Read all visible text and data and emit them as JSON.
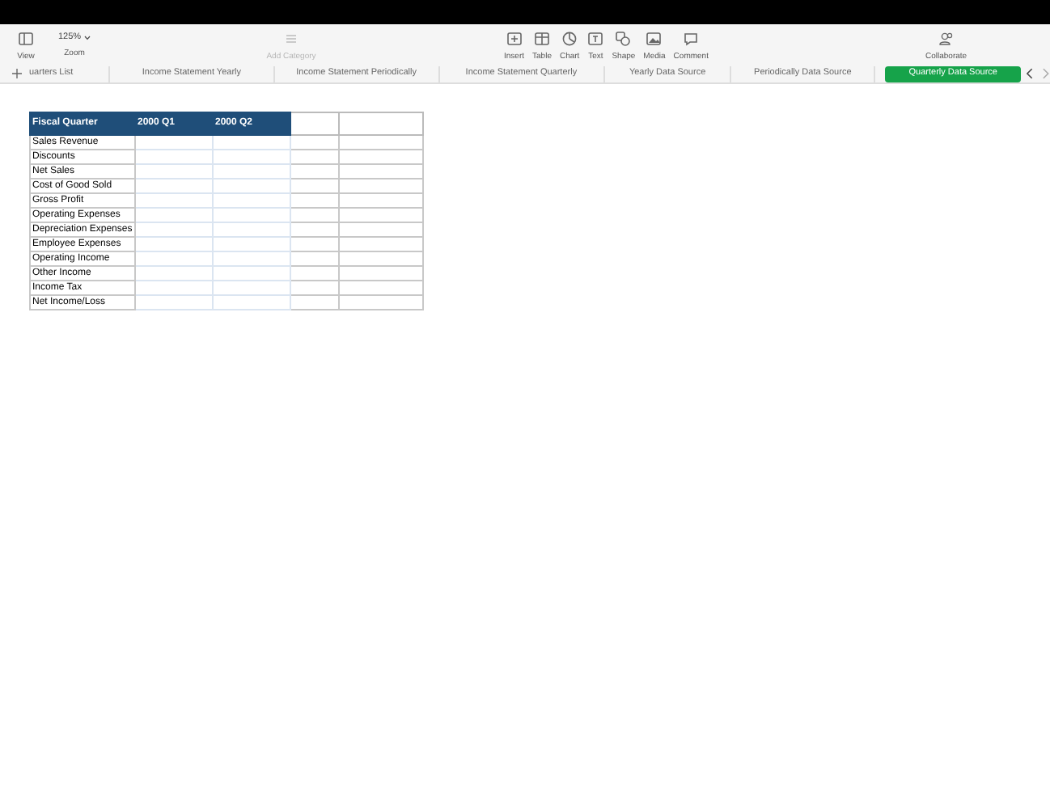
{
  "toolbar": {
    "left": [
      {
        "kind": "view",
        "label": "View"
      },
      {
        "kind": "zoom",
        "label": "Zoom",
        "value": "125%"
      }
    ],
    "add_category": {
      "label": "Add Category",
      "disabled": true
    },
    "center": [
      {
        "kind": "insert",
        "label": "Insert"
      },
      {
        "kind": "table",
        "label": "Table"
      },
      {
        "kind": "chart",
        "label": "Chart"
      },
      {
        "kind": "text",
        "label": "Text"
      },
      {
        "kind": "shape",
        "label": "Shape"
      },
      {
        "kind": "media",
        "label": "Media"
      },
      {
        "kind": "comment",
        "label": "Comment"
      }
    ],
    "right": {
      "label": "Collaborate"
    }
  },
  "tabs": [
    {
      "label": "uarters List",
      "selected": false
    },
    {
      "label": "Income Statement Yearly",
      "selected": false
    },
    {
      "label": "Income Statement Periodically",
      "selected": false
    },
    {
      "label": "Income Statement Quarterly",
      "selected": false
    },
    {
      "label": "Yearly Data Source",
      "selected": false
    },
    {
      "label": "Periodically Data Source",
      "selected": false
    },
    {
      "label": "Quarterly Data Source",
      "selected": true
    }
  ],
  "table": {
    "columns": [
      "Fiscal Quarter",
      "2000 Q1",
      "2000 Q2"
    ],
    "rows": [
      "Sales Revenue",
      "Discounts",
      "Net Sales",
      "Cost of Good Sold",
      "Gross Profit",
      "Operating Expenses",
      "Depreciation Expenses",
      "Employee Expenses",
      "Operating Income",
      "Other Income",
      "Income Tax",
      "Net Income/Loss"
    ]
  }
}
